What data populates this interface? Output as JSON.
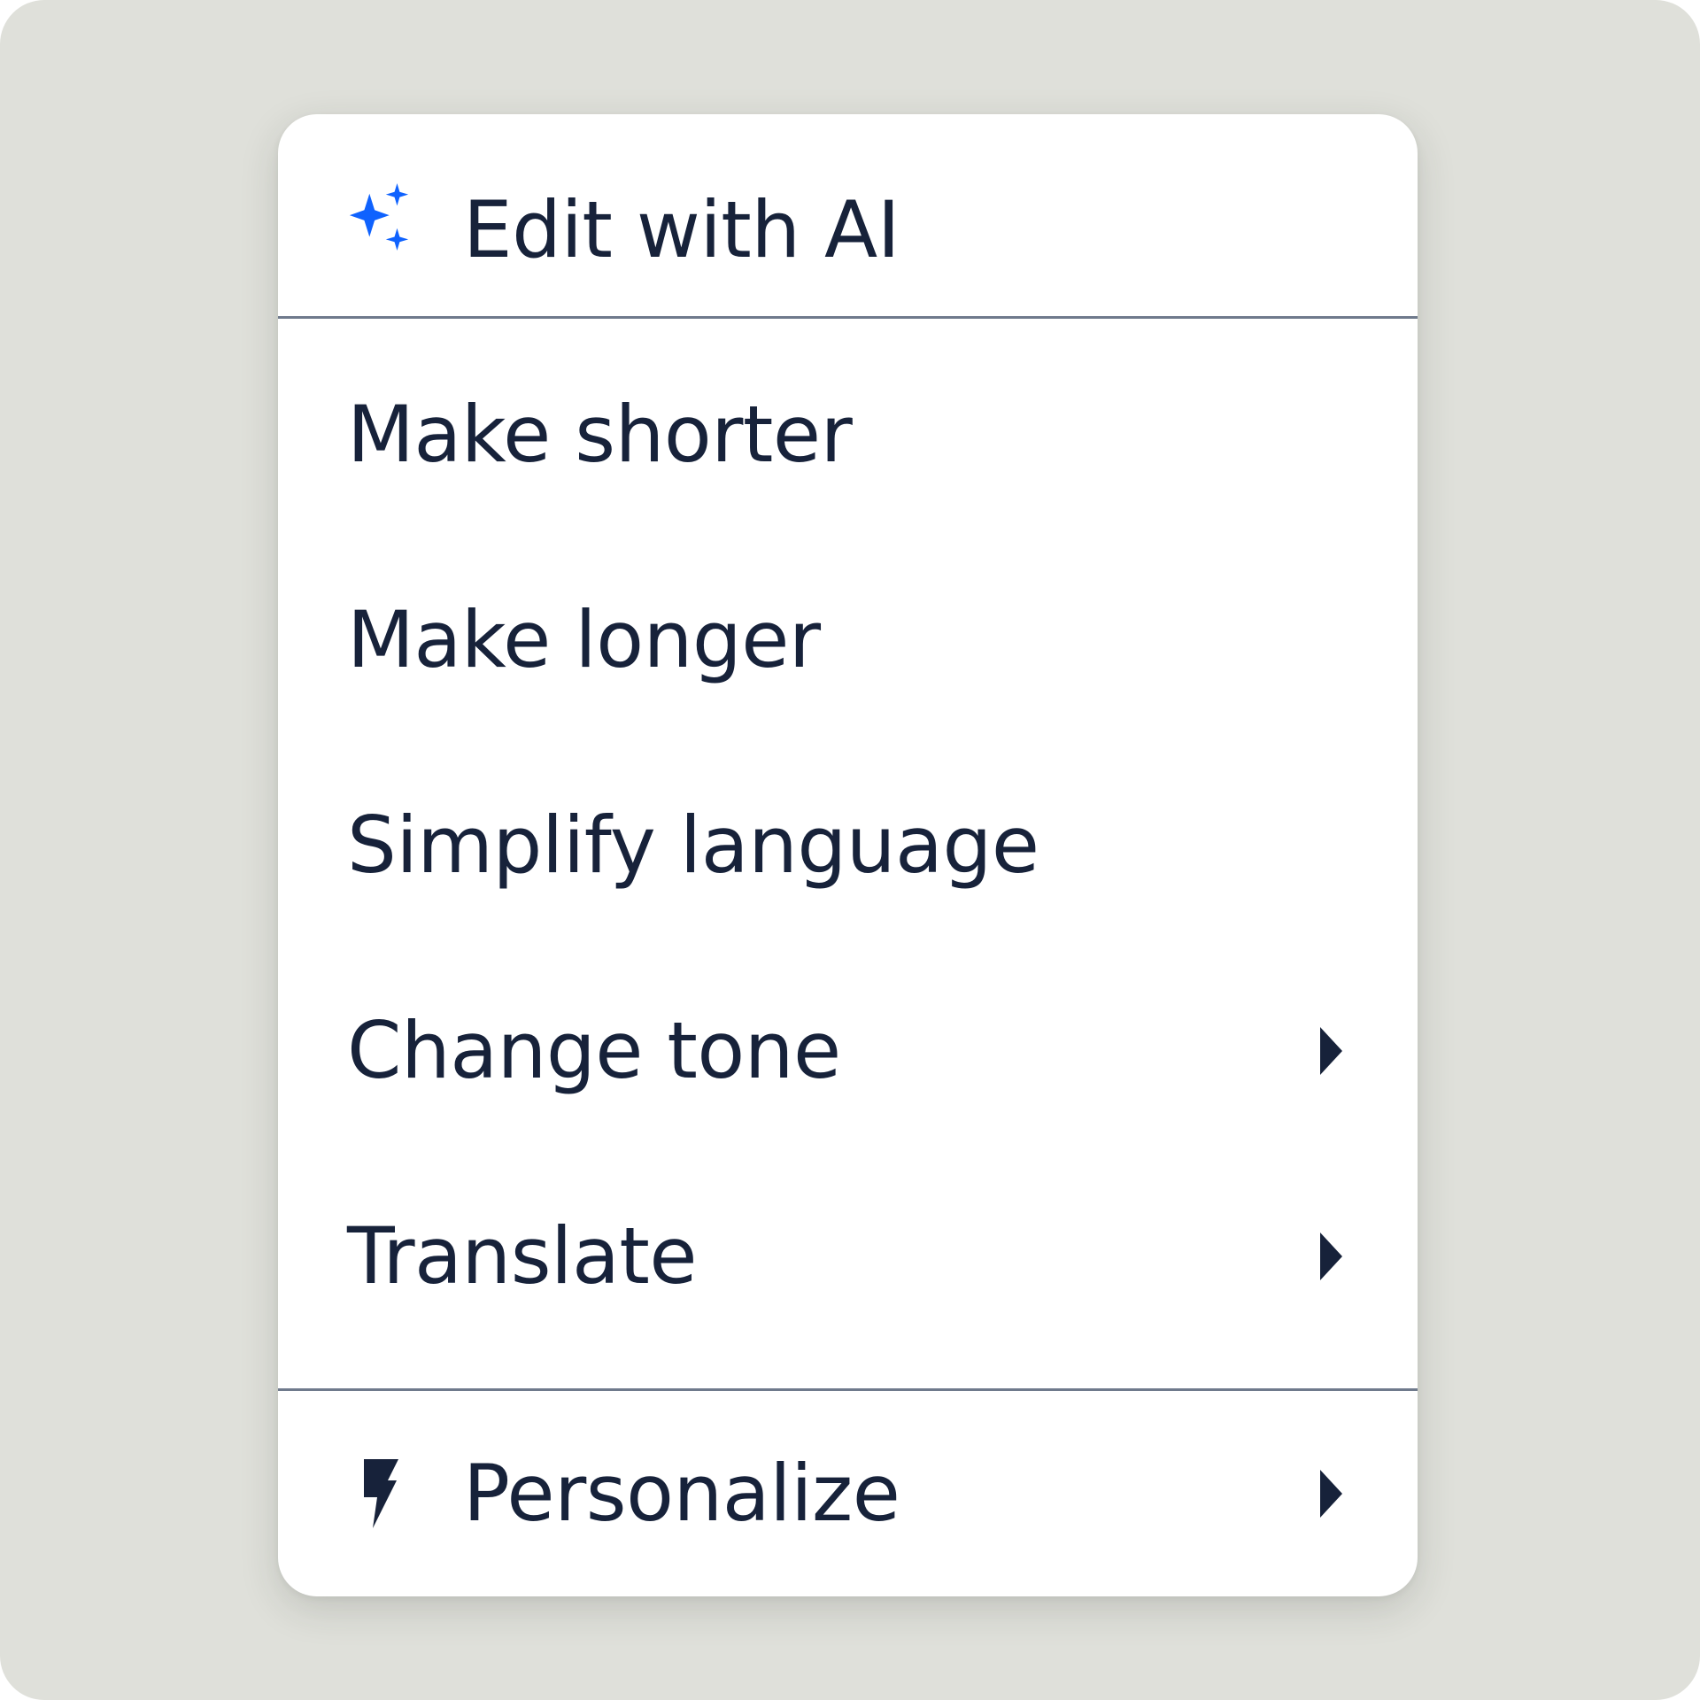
{
  "colors": {
    "background": "#dfe0da",
    "menu": "#ffffff",
    "text": "#17223a",
    "divider": "#6f7a8c",
    "ai_icon": "#0f62fe"
  },
  "menu": {
    "header": {
      "icon": "ai-sparkle-icon",
      "label": "Edit with AI"
    },
    "items": [
      {
        "label": "Make shorter",
        "submenu": false
      },
      {
        "label": "Make longer",
        "submenu": false
      },
      {
        "label": "Simplify language",
        "submenu": false
      },
      {
        "label": "Change tone",
        "submenu": true,
        "submenu_icon": "chevron-right-icon"
      },
      {
        "label": "Translate",
        "submenu": true,
        "submenu_icon": "chevron-right-icon"
      }
    ],
    "footer": {
      "icon": "lightning-bolt-icon",
      "label": "Personalize",
      "submenu": true,
      "submenu_icon": "chevron-right-icon"
    }
  }
}
